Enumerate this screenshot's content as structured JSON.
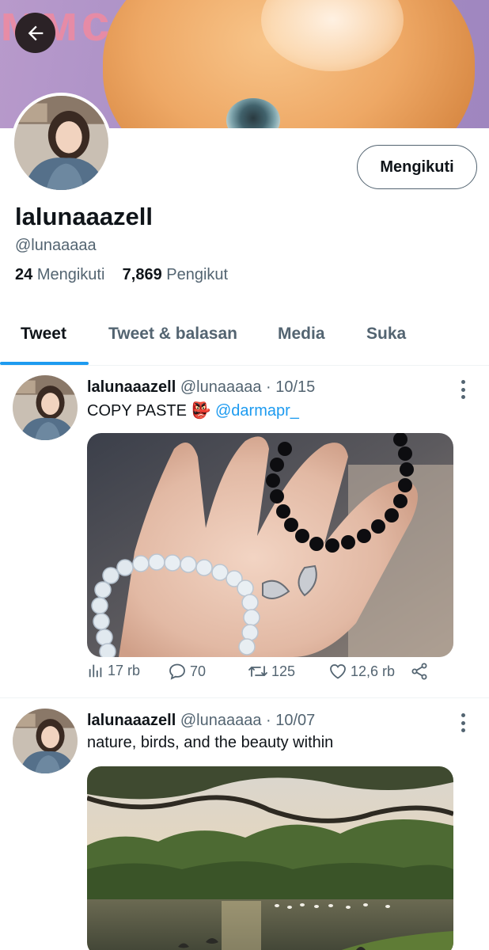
{
  "header": {
    "back_icon": "arrow-left-icon"
  },
  "profile": {
    "display_name": "lalunaaazell",
    "handle": "@lunaaaaa",
    "following_count": "24",
    "following_label": "Mengikuti",
    "followers_count": "7,869",
    "followers_label": "Pengikut",
    "follow_button_label": "Mengikuti"
  },
  "tabs": [
    {
      "label": "Tweet",
      "active": true
    },
    {
      "label": "Tweet & balasan",
      "active": false
    },
    {
      "label": "Media",
      "active": false
    },
    {
      "label": "Suka",
      "active": false
    }
  ],
  "tweets": [
    {
      "name": "lalunaaazell",
      "handle": "@lunaaaaa",
      "date": "10/15",
      "separator": "·",
      "text": "COPY PASTE",
      "emoji": "👺",
      "mention": "@darmapr_",
      "views": "17 rb",
      "replies": "70",
      "retweets": "125",
      "likes": "12,6 rb"
    },
    {
      "name": "lalunaaazell",
      "handle": "@lunaaaaa",
      "date": "10/07",
      "separator": "·",
      "text": "nature, birds, and the beauty within"
    }
  ],
  "colors": {
    "accent": "#1d9bf0",
    "text_primary": "#0f1419",
    "text_secondary": "#536471",
    "banner_purple": "#a98fc6"
  }
}
